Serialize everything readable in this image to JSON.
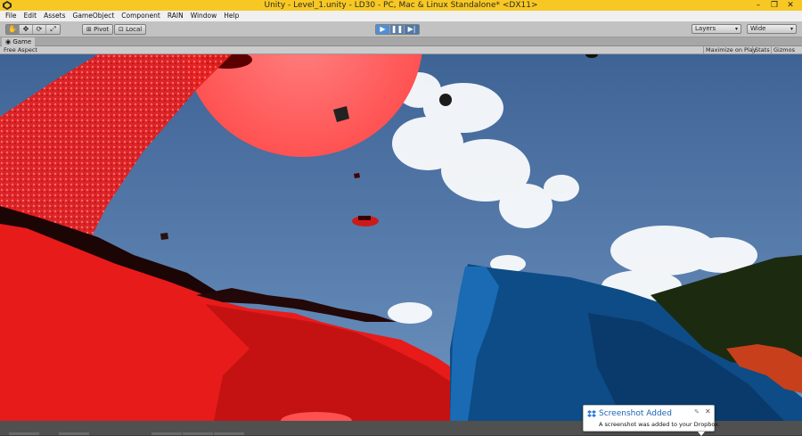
{
  "window": {
    "title": "Unity - Level_1.unity - LD30 - PC, Mac & Linux Standalone* <DX11>",
    "controls": {
      "minimize": "–",
      "restore": "❐",
      "close": "✕"
    }
  },
  "menu": [
    "File",
    "Edit",
    "Assets",
    "GameObject",
    "Component",
    "RAIN",
    "Window",
    "Help"
  ],
  "toolbar": {
    "transform_tools": [
      "hand-icon",
      "move-icon",
      "rotate-icon",
      "scale-icon"
    ],
    "pivot_label": "Pivot",
    "local_label": "Local",
    "play_controls": [
      "play-icon",
      "pause-icon",
      "step-icon"
    ],
    "layers_label": "Layers",
    "layout_label": "Wide"
  },
  "game_view": {
    "tab_label": "Game",
    "aspect_label": "Free Aspect",
    "maximize_label": "Maximize on Play",
    "stats_label": "Stats",
    "gizmos_label": "Gizmos"
  },
  "notification": {
    "title": "Screenshot Added",
    "body": "A screenshot was added to your Dropbox.",
    "icon": "dropbox-icon"
  },
  "colors": {
    "title_bar": "#f7c823",
    "sky": "#4b6c98",
    "red_object": "#ff2020",
    "blue_object": "#0d4c86",
    "play_accent": "#4f8fd6"
  }
}
